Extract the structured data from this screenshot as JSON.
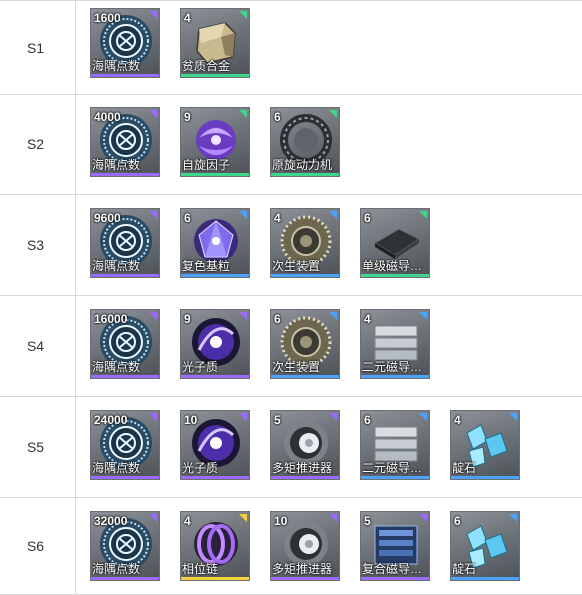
{
  "colors": {
    "purple": "#9b6bff",
    "green": "#3fd58a",
    "blue": "#4aa3ff",
    "yellow": "#f5d23a"
  },
  "rows": [
    {
      "label": "S1",
      "items": [
        {
          "count": "1600",
          "name": "海隅点数",
          "rarity": "purple",
          "icon": "sea-token-icon"
        },
        {
          "count": "4",
          "name": "贫质合金",
          "rarity": "green",
          "icon": "alloy-ingot-icon"
        }
      ]
    },
    {
      "label": "S2",
      "items": [
        {
          "count": "4000",
          "name": "海隅点数",
          "rarity": "purple",
          "icon": "sea-token-icon"
        },
        {
          "count": "9",
          "name": "自旋因子",
          "rarity": "green",
          "icon": "spin-factor-icon"
        },
        {
          "count": "6",
          "name": "原旋动力机",
          "rarity": "green",
          "icon": "spin-engine-icon"
        }
      ]
    },
    {
      "label": "S3",
      "items": [
        {
          "count": "9600",
          "name": "海隅点数",
          "rarity": "purple",
          "icon": "sea-token-icon"
        },
        {
          "count": "6",
          "name": "复色基粒",
          "rarity": "blue",
          "icon": "crystal-orb-icon"
        },
        {
          "count": "4",
          "name": "次生装置",
          "rarity": "blue",
          "icon": "ring-device-icon"
        },
        {
          "count": "6",
          "name": "单级磁导插…",
          "rarity": "green",
          "icon": "magnetic-plate-icon"
        }
      ]
    },
    {
      "label": "S4",
      "items": [
        {
          "count": "16000",
          "name": "海隅点数",
          "rarity": "purple",
          "icon": "sea-token-icon"
        },
        {
          "count": "9",
          "name": "光子质",
          "rarity": "purple",
          "icon": "photon-orb-icon"
        },
        {
          "count": "6",
          "name": "次生装置",
          "rarity": "blue",
          "icon": "ring-device-icon"
        },
        {
          "count": "4",
          "name": "二元磁导插…",
          "rarity": "blue",
          "icon": "magnetic-stack-icon"
        }
      ]
    },
    {
      "label": "S5",
      "items": [
        {
          "count": "24000",
          "name": "海隅点数",
          "rarity": "purple",
          "icon": "sea-token-icon"
        },
        {
          "count": "10",
          "name": "光子质",
          "rarity": "purple",
          "icon": "photon-orb-icon"
        },
        {
          "count": "5",
          "name": "多矩推进器",
          "rarity": "purple",
          "icon": "thruster-icon"
        },
        {
          "count": "6",
          "name": "二元磁导插…",
          "rarity": "blue",
          "icon": "magnetic-stack-icon"
        },
        {
          "count": "4",
          "name": "靛石",
          "rarity": "blue",
          "icon": "indigo-crystal-icon"
        }
      ]
    },
    {
      "label": "S6",
      "items": [
        {
          "count": "32000",
          "name": "海隅点数",
          "rarity": "purple",
          "icon": "sea-token-icon"
        },
        {
          "count": "4",
          "name": "相位链",
          "rarity": "yellow",
          "icon": "phase-chain-icon"
        },
        {
          "count": "10",
          "name": "多矩推进器",
          "rarity": "purple",
          "icon": "thruster-icon"
        },
        {
          "count": "5",
          "name": "复合磁导插…",
          "rarity": "purple",
          "icon": "magnetic-block-icon"
        },
        {
          "count": "6",
          "name": "靛石",
          "rarity": "blue",
          "icon": "indigo-crystal-icon"
        }
      ]
    }
  ]
}
